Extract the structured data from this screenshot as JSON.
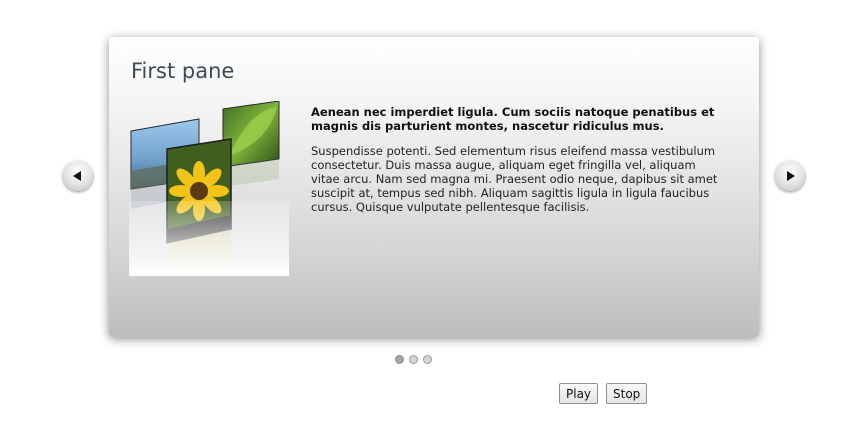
{
  "slider": {
    "current_pane": {
      "title": "First pane",
      "image_icon": "photo-stack-icon",
      "lead_text": "Aenean nec imperdiet ligula. Cum sociis natoque penatibus et magnis dis parturient montes, nascetur ridiculus mus.",
      "body_text": "Suspendisse potenti. Sed elementum risus eleifend massa vestibulum consectetur. Duis massa augue, aliquam eget fringilla vel, aliquam vitae arcu. Nam sed magna mi. Praesent odio neque, dapibus sit amet suscipit at, tempus sed nibh. Aliquam sagittis ligula in ligula faucibus cursus. Quisque vulputate pellentesque facilisis."
    },
    "prev_icon": "arrow-left-icon",
    "next_icon": "arrow-right-icon",
    "pager": {
      "count": 3,
      "active_index": 0
    }
  },
  "controls": {
    "play_label": "Play",
    "stop_label": "Stop"
  }
}
